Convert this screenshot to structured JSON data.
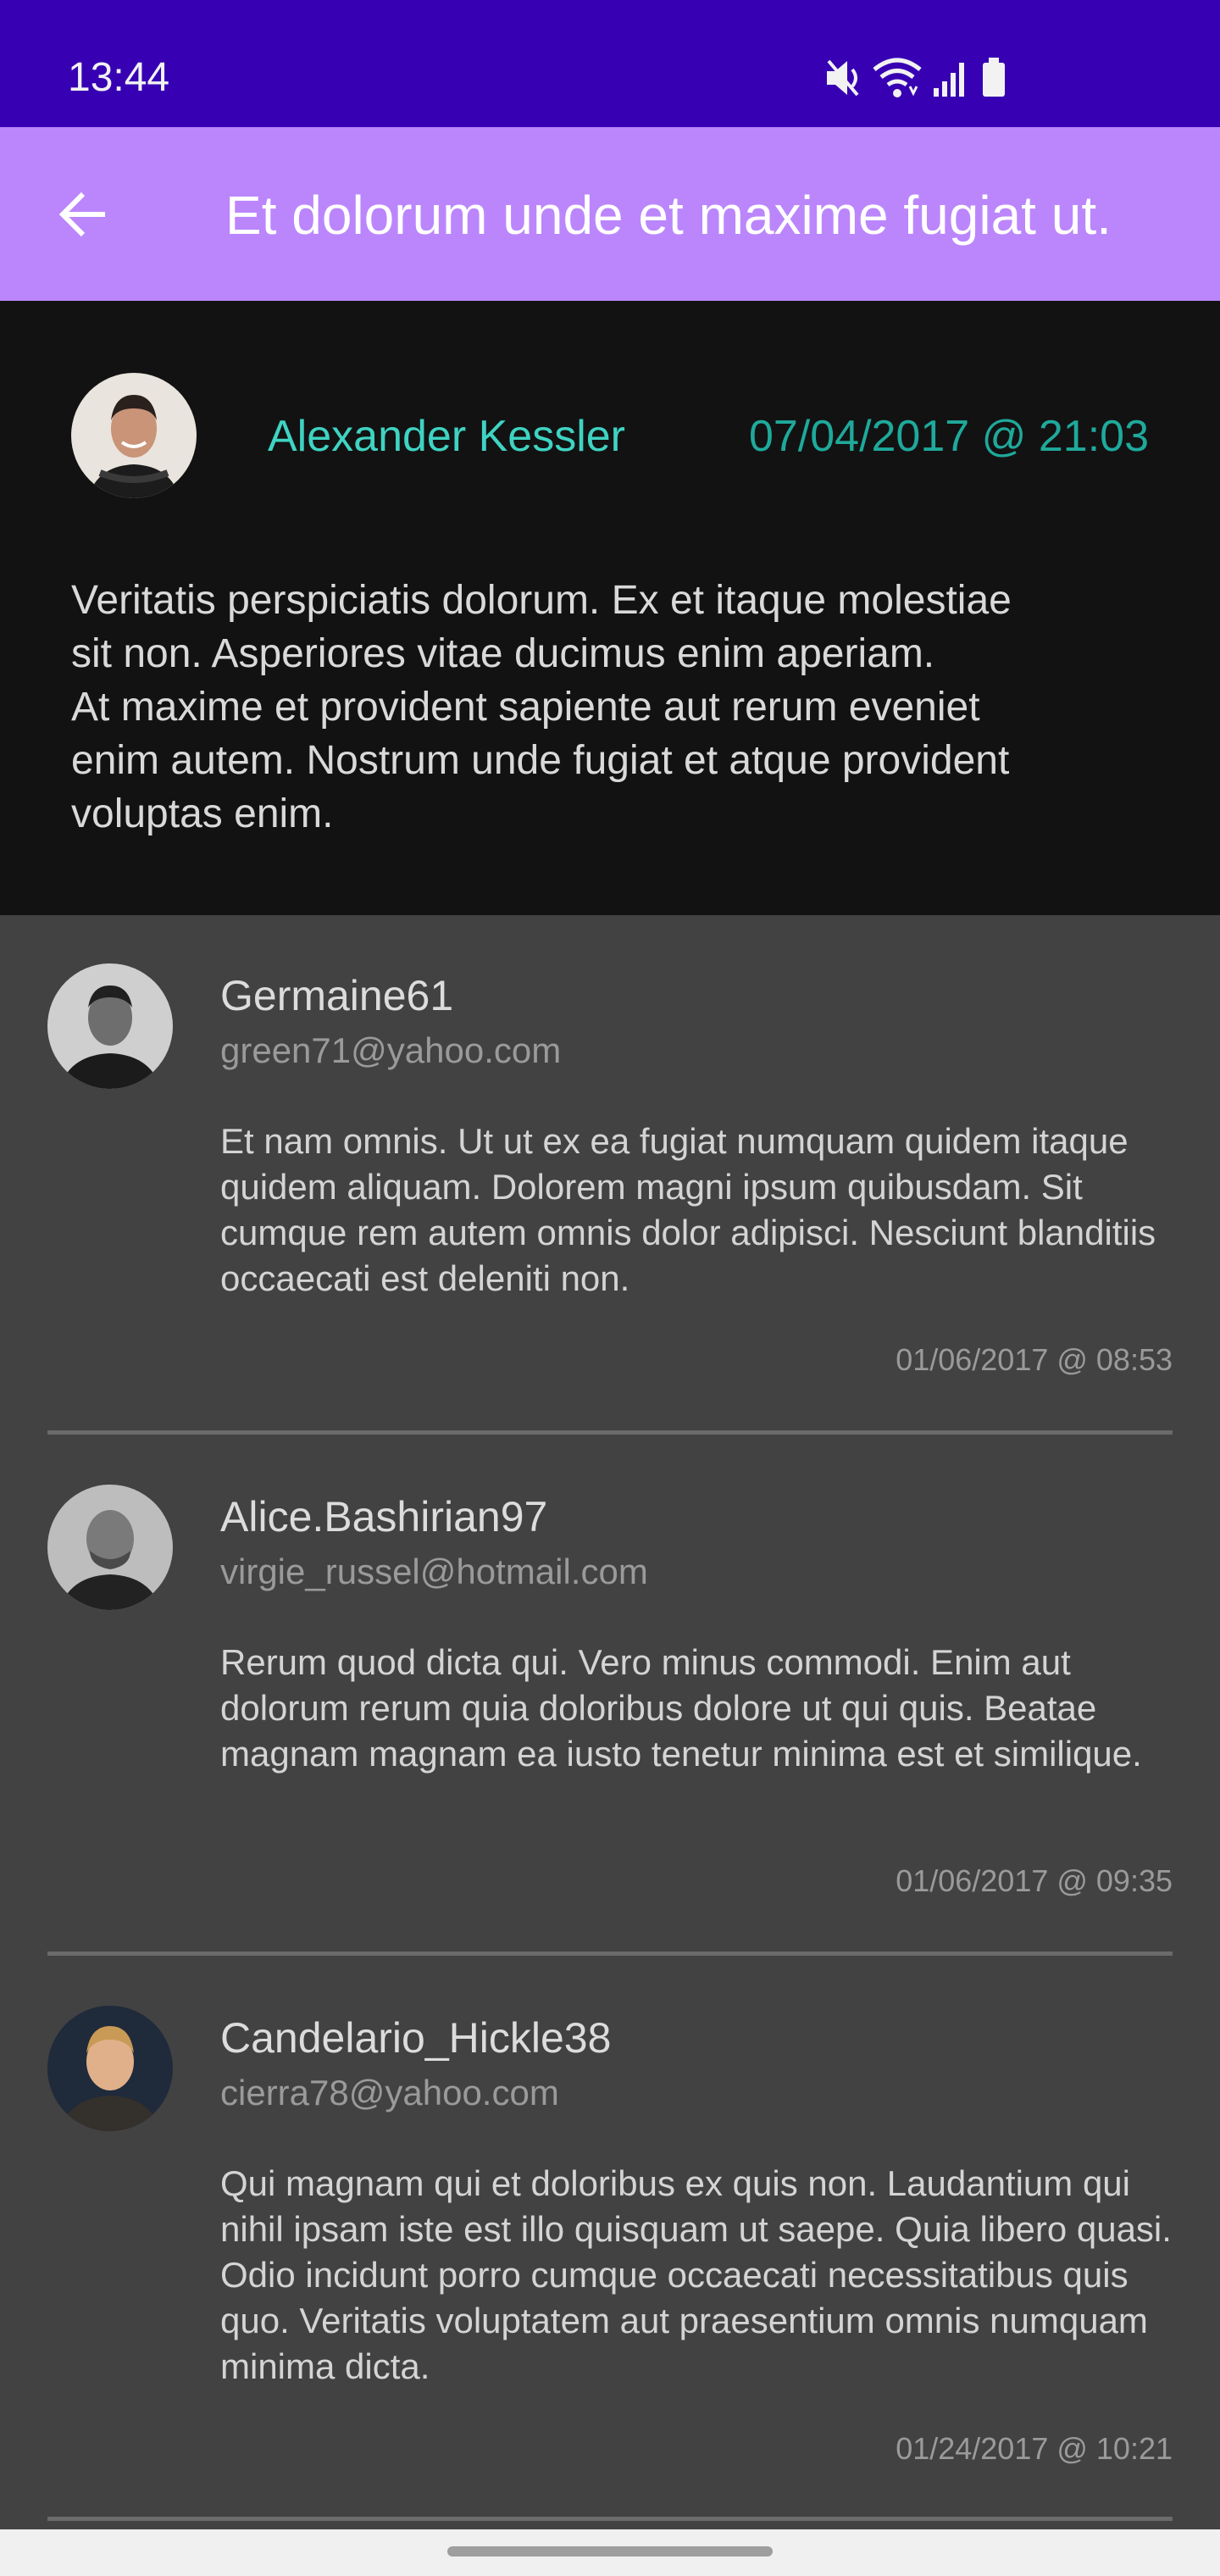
{
  "status_bar": {
    "time": "13:44",
    "icons": [
      "mute-icon",
      "wifi-icon",
      "signal-icon",
      "battery-icon"
    ]
  },
  "app_bar": {
    "title": "Et dolorum unde et maxime fugiat ut.",
    "back_icon": "arrow-back-icon"
  },
  "post": {
    "author": "Alexander Kessler",
    "date": "07/04/2017 @ 21:03",
    "body": "Veritatis perspiciatis dolorum. Ex et itaque molestiae\nsit non. Asperiores vitae ducimus enim aperiam.\nAt maxime et provident sapiente aut rerum eveniet\nenim autem. Nostrum unde fugiat et atque provident\nvoluptas enim."
  },
  "comments": [
    {
      "username": "Germaine61",
      "email": "green71@yahoo.com",
      "body": "Et nam omnis. Ut ut ex ea fugiat numquam quidem itaque quidem aliquam. Dolorem magni ipsum quibusdam. Sit cumque rem autem omnis dolor adipisci. Nesciunt blanditiis occaecati est deleniti non.",
      "date": "01/06/2017 @ 08:53"
    },
    {
      "username": "Alice.Bashirian97",
      "email": "virgie_russel@hotmail.com",
      "body": "Rerum quod dicta qui. Vero minus commodi. Enim aut dolorum rerum quia doloribus dolore ut qui quis. Beatae magnam magnam ea iusto tenetur minima est et similique.",
      "date": "01/06/2017 @ 09:35"
    },
    {
      "username": "Candelario_Hickle38",
      "email": "cierra78@yahoo.com",
      "body": "Qui magnam qui et doloribus ex quis non. Laudantium qui nihil ipsam iste est illo quisquam ut saepe. Quia libero quasi. Odio incidunt porro cumque occaecati necessitatibus quis quo. Veritatis voluptatem aut praesentium omnis numquam minima dicta.",
      "date": "01/24/2017 @ 10:21"
    }
  ],
  "colors": {
    "status_bar": "#3700b3",
    "app_bar": "#bb86fc",
    "post_background": "#121212",
    "author_accent": "#3fd3c2",
    "comments_background": "#424242"
  }
}
